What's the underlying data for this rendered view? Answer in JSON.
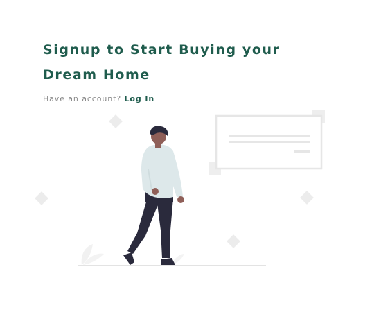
{
  "hero": {
    "heading_line1": "Signup to Start Buying your",
    "heading_line2": "Dream Home",
    "account_prompt": "Have an account?",
    "login_label": "Log In"
  },
  "colors": {
    "brand_green": "#1f5c4d",
    "muted_text": "#8a8a8a",
    "figure_shirt": "#dde8ea",
    "figure_pants": "#2a2a3c",
    "figure_skin": "#8f5f58",
    "decor_gray": "#ebebeb"
  },
  "illustration": {
    "icon": "person-walking-illustration"
  }
}
